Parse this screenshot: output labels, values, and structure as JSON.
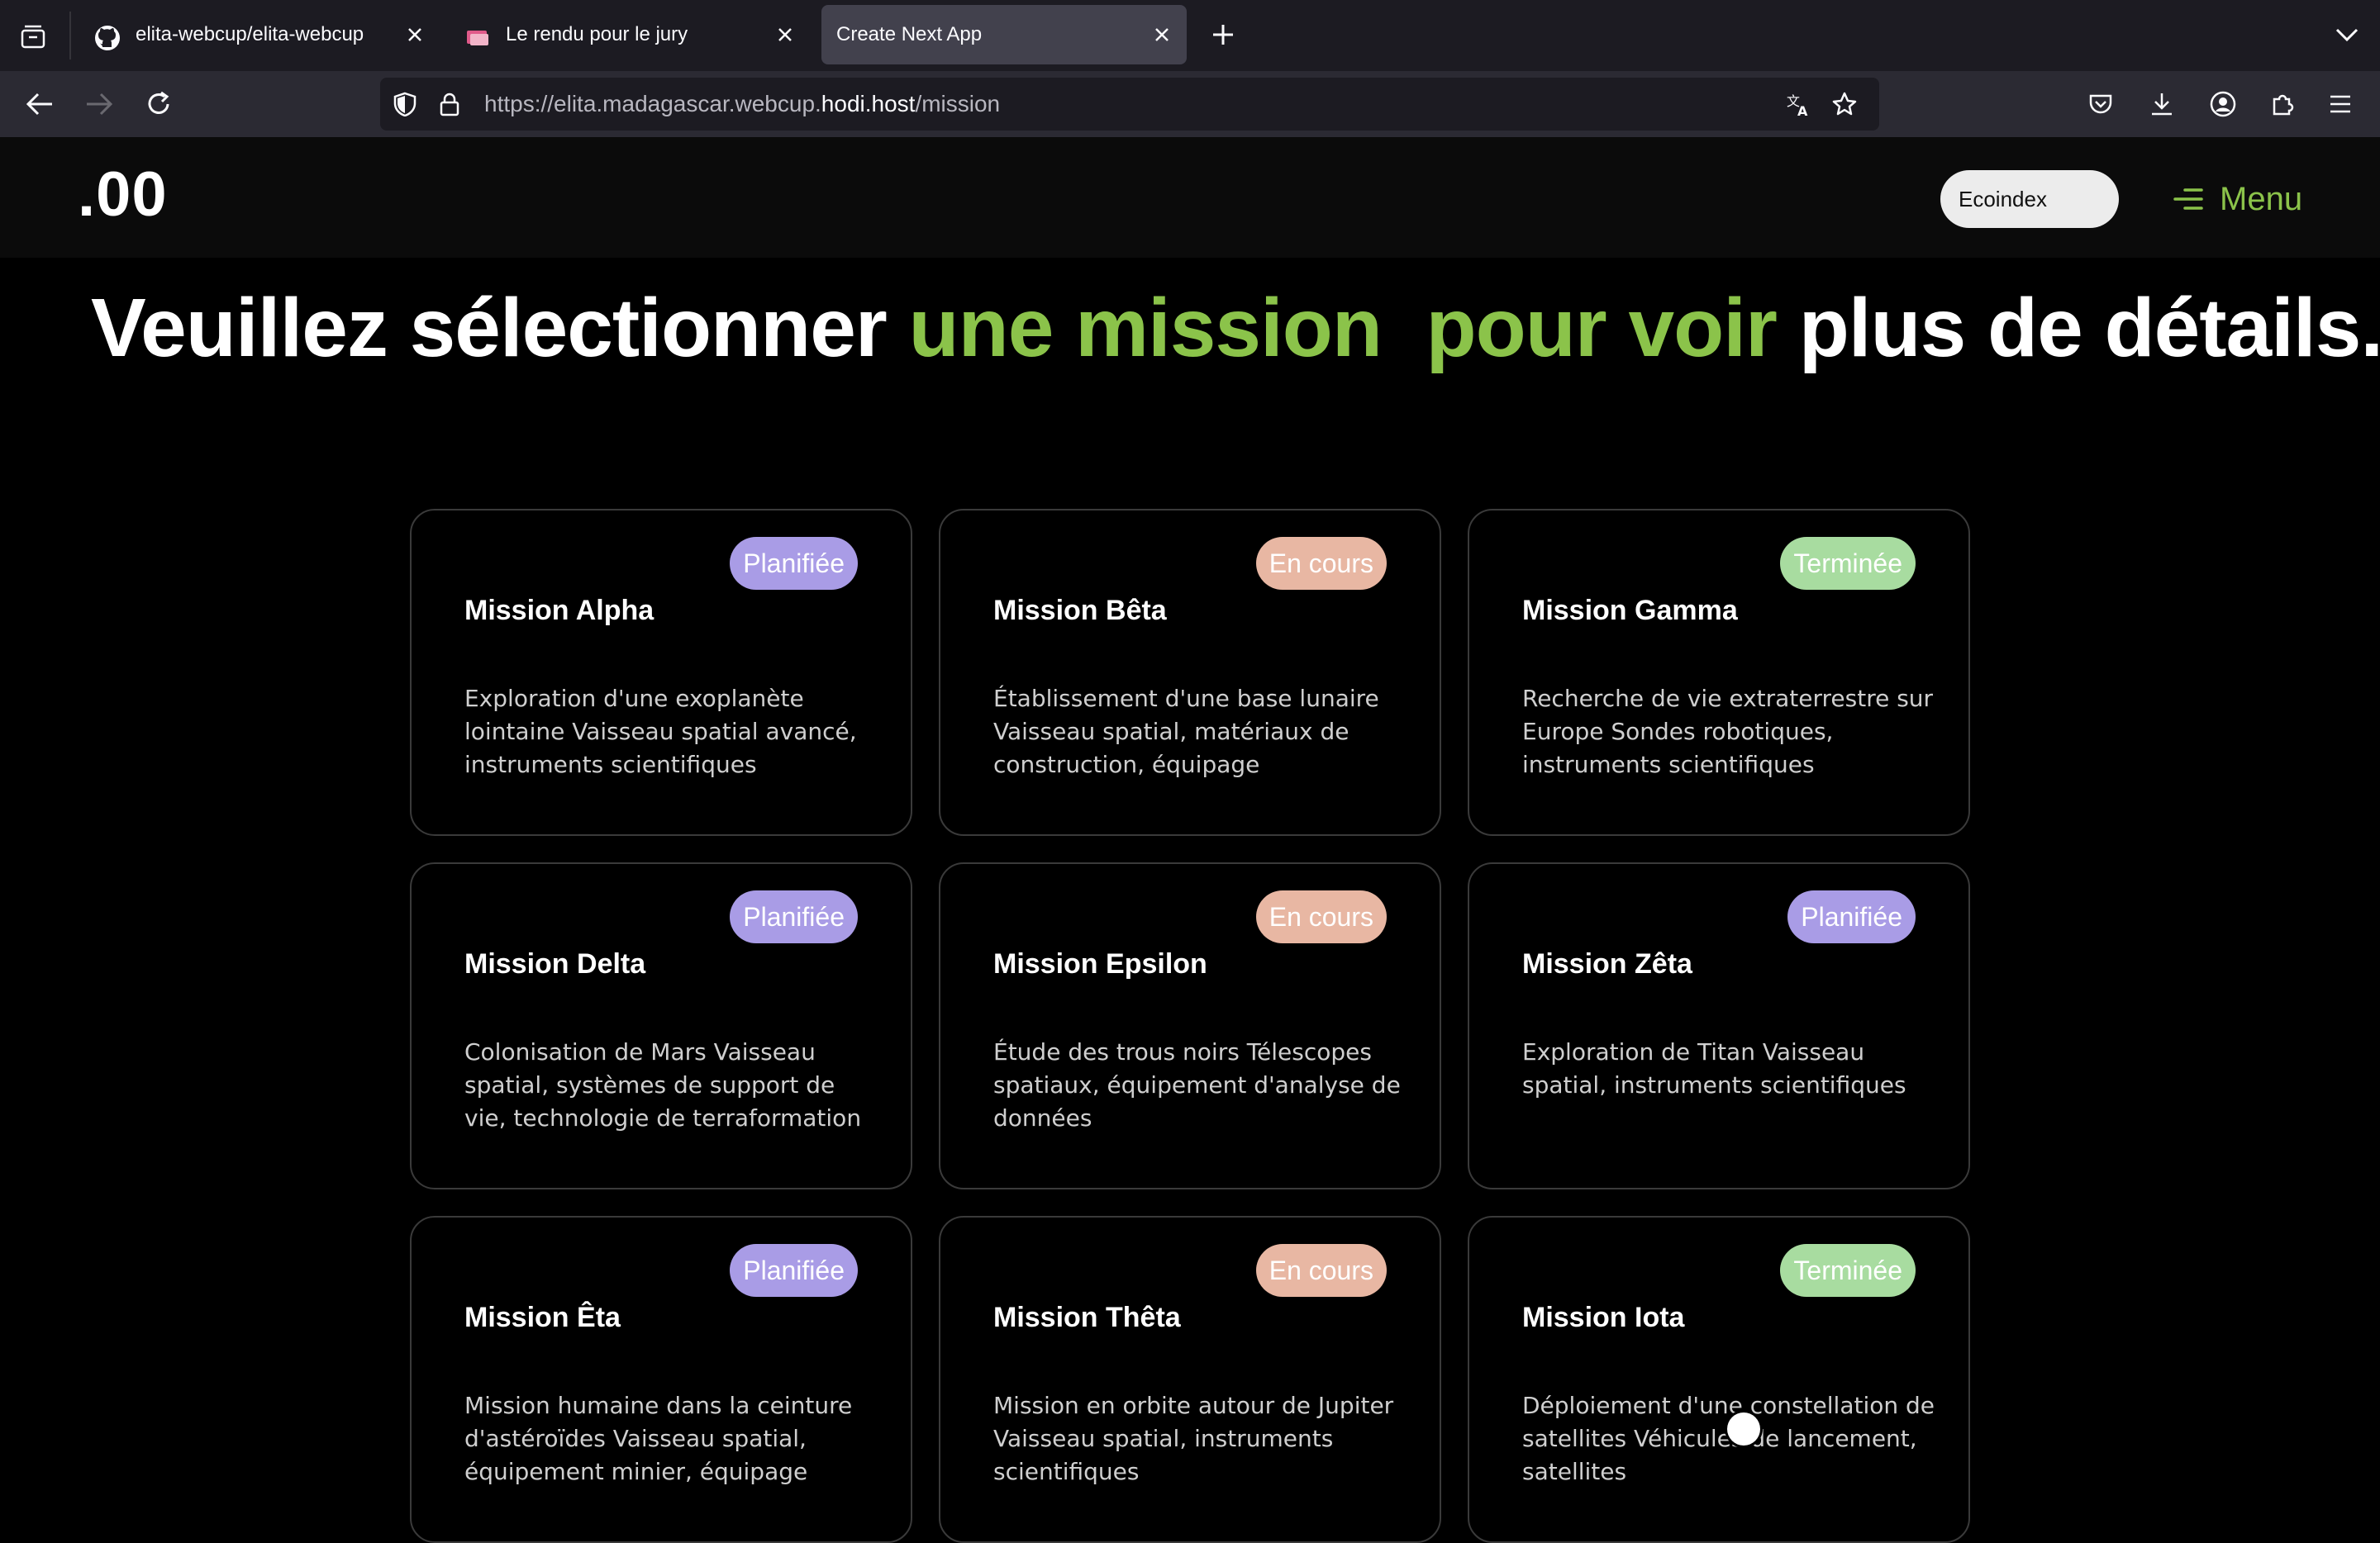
{
  "browser": {
    "tabs": [
      {
        "title": "elita-webcup/elita-webcup",
        "favicon": "github-icon"
      },
      {
        "title": "Le rendu pour le jury",
        "favicon": "slides-icon"
      },
      {
        "title": "Create Next App",
        "favicon": "none",
        "active": true
      }
    ],
    "url": {
      "prefix": "https://elita.madagascar.webcup.",
      "host": "hodi.host",
      "path": "/mission"
    }
  },
  "header": {
    "logo": ".00",
    "ecoindex_label": "Ecoindex",
    "menu_label": "Menu"
  },
  "headline": {
    "part1": "Veuillez sélectionner ",
    "accent": "une mission  pour voir",
    "part2": " plus de détails."
  },
  "colors": {
    "accent": "#8bc34a",
    "planned": "#a99ce6",
    "in_progress": "#e8b7a3",
    "done": "#a8dca0"
  },
  "missions": [
    {
      "name": "Mission Alpha",
      "status": "Planifiée",
      "desc": "Exploration d'une exoplanète lointaine Vaisseau spatial avancé, instruments scientifiques"
    },
    {
      "name": "Mission Bêta",
      "status": "En cours",
      "desc": "Établissement d'une base lunaire Vaisseau spatial, matériaux de construction, équipage"
    },
    {
      "name": "Mission Gamma",
      "status": "Terminée",
      "desc": "Recherche de vie extraterrestre sur Europe Sondes robotiques, instruments scientifiques"
    },
    {
      "name": "Mission Delta",
      "status": "Planifiée",
      "desc": "Colonisation de Mars Vaisseau spatial, systèmes de support de vie, technologie de terraformation"
    },
    {
      "name": "Mission Epsilon",
      "status": "En cours",
      "desc": "Étude des trous noirs Télescopes spatiaux, équipement d'analyse de données"
    },
    {
      "name": "Mission Zêta",
      "status": "Planifiée",
      "desc": "Exploration de Titan Vaisseau spatial, instruments scientifiques"
    },
    {
      "name": "Mission Êta",
      "status": "Planifiée",
      "desc": "Mission humaine dans la ceinture d'astéroïdes Vaisseau spatial, équipement minier, équipage"
    },
    {
      "name": "Mission Thêta",
      "status": "En cours",
      "desc": "Mission en orbite autour de Jupiter Vaisseau spatial, instruments scientifiques"
    },
    {
      "name": "Mission Iota",
      "status": "Terminée",
      "desc": "Déploiement d'une constellation de satellites Véhicules de lancement, satellites"
    }
  ]
}
